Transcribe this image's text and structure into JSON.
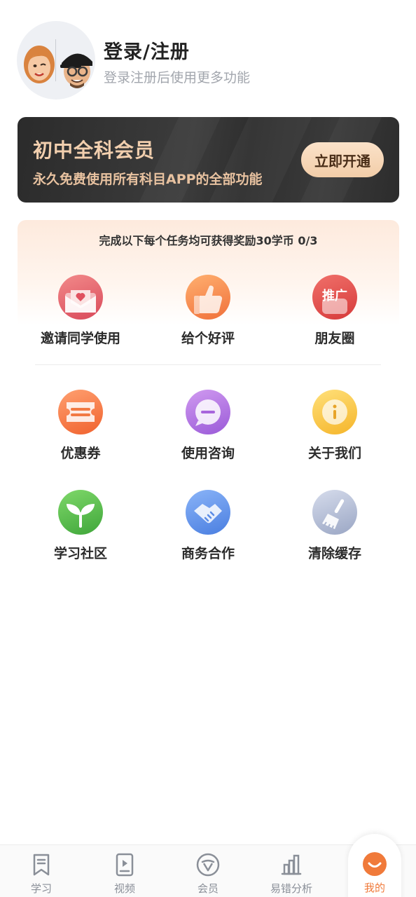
{
  "profile": {
    "title": "登录/注册",
    "subtitle": "登录注册后使用更多功能"
  },
  "vip": {
    "title": "初中全科会员",
    "subtitle": "永久免费使用所有科目APP的全部功能",
    "button": "立即开通"
  },
  "tasks": {
    "title": "完成以下每个任务均可获得奖励30学币 0/3",
    "items": [
      {
        "label": "邀请同学使用",
        "icon": "envelope-icon"
      },
      {
        "label": "给个好评",
        "icon": "thumbs-up-icon"
      },
      {
        "label": "朋友圈",
        "icon": "promote-icon",
        "icon_text": "推广"
      }
    ]
  },
  "services": {
    "items": [
      {
        "label": "优惠券",
        "icon": "coupon-icon"
      },
      {
        "label": "使用咨询",
        "icon": "chat-icon"
      },
      {
        "label": "关于我们",
        "icon": "info-icon"
      },
      {
        "label": "学习社区",
        "icon": "sprout-icon"
      },
      {
        "label": "商务合作",
        "icon": "handshake-icon"
      },
      {
        "label": "清除缓存",
        "icon": "broom-icon"
      }
    ]
  },
  "tabbar": {
    "tabs": [
      {
        "label": "学习",
        "icon": "bookmark-icon"
      },
      {
        "label": "视频",
        "icon": "video-icon"
      },
      {
        "label": "会员",
        "icon": "vip-icon"
      },
      {
        "label": "易错分析",
        "icon": "chart-icon"
      },
      {
        "label": "我的",
        "icon": "smile-icon",
        "active": true
      }
    ]
  },
  "colors": {
    "accent": "#f07a3a",
    "vip_gold": "#f2cfae",
    "tab_inactive": "#8a8f98"
  }
}
